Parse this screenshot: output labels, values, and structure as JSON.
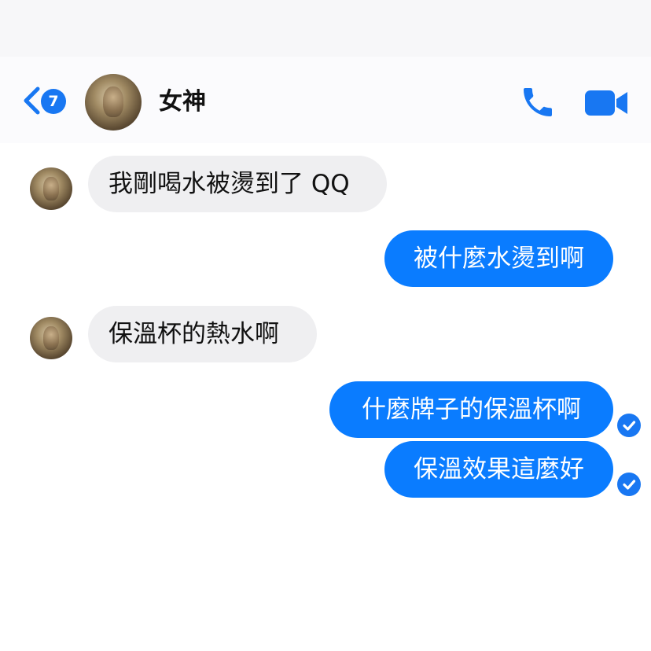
{
  "header": {
    "unread_count": "7",
    "contact_name": "女神"
  },
  "messages": [
    {
      "from": "contact",
      "text": "我剛喝水被燙到了 QQ"
    },
    {
      "from": "me",
      "text": "被什麼水燙到啊"
    },
    {
      "from": "contact",
      "text": "保溫杯的熱水啊"
    },
    {
      "from": "me",
      "text": "什麼牌子的保溫杯啊",
      "status": "sent"
    },
    {
      "from": "me",
      "text": "保溫效果這麼好",
      "status": "sent"
    }
  ],
  "colors": {
    "accent": "#1877f2",
    "outgoing_bubble": "#0a7cff",
    "incoming_bubble": "#efeff1"
  }
}
